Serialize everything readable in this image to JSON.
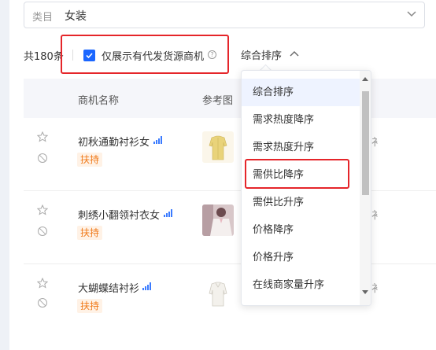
{
  "category": {
    "label": "类目",
    "value": "女装"
  },
  "filter_bar": {
    "total": "共180条",
    "checkbox_label": "仅展示有代发货源商机",
    "checkbox_checked": true,
    "help_glyph": "?",
    "sort_label": "综合排序"
  },
  "table": {
    "headers": {
      "name": "商机名称",
      "image": "参考图"
    },
    "rows": [
      {
        "name": "初秋通勤衬衫女",
        "badge": "扶持",
        "trunc": "衤"
      },
      {
        "name": "刺绣小翻领衬衣女",
        "badge": "扶持",
        "trunc": "衤"
      },
      {
        "name": "大蝴蝶结衬衫",
        "badge": "扶持",
        "trunc": "衤"
      }
    ]
  },
  "sort_dropdown": {
    "options": [
      "综合排序",
      "需求热度降序",
      "需求热度升序",
      "需供比降序",
      "需供比升序",
      "价格降序",
      "价格升序",
      "在线商家量升序"
    ],
    "active_option": "综合排序",
    "highlighted_option": "需供比降序"
  },
  "colors": {
    "accent": "#1a66ff",
    "badge_text": "#f07a1a",
    "badge_bg": "#fff2e6",
    "annotation": "#e5252a"
  }
}
